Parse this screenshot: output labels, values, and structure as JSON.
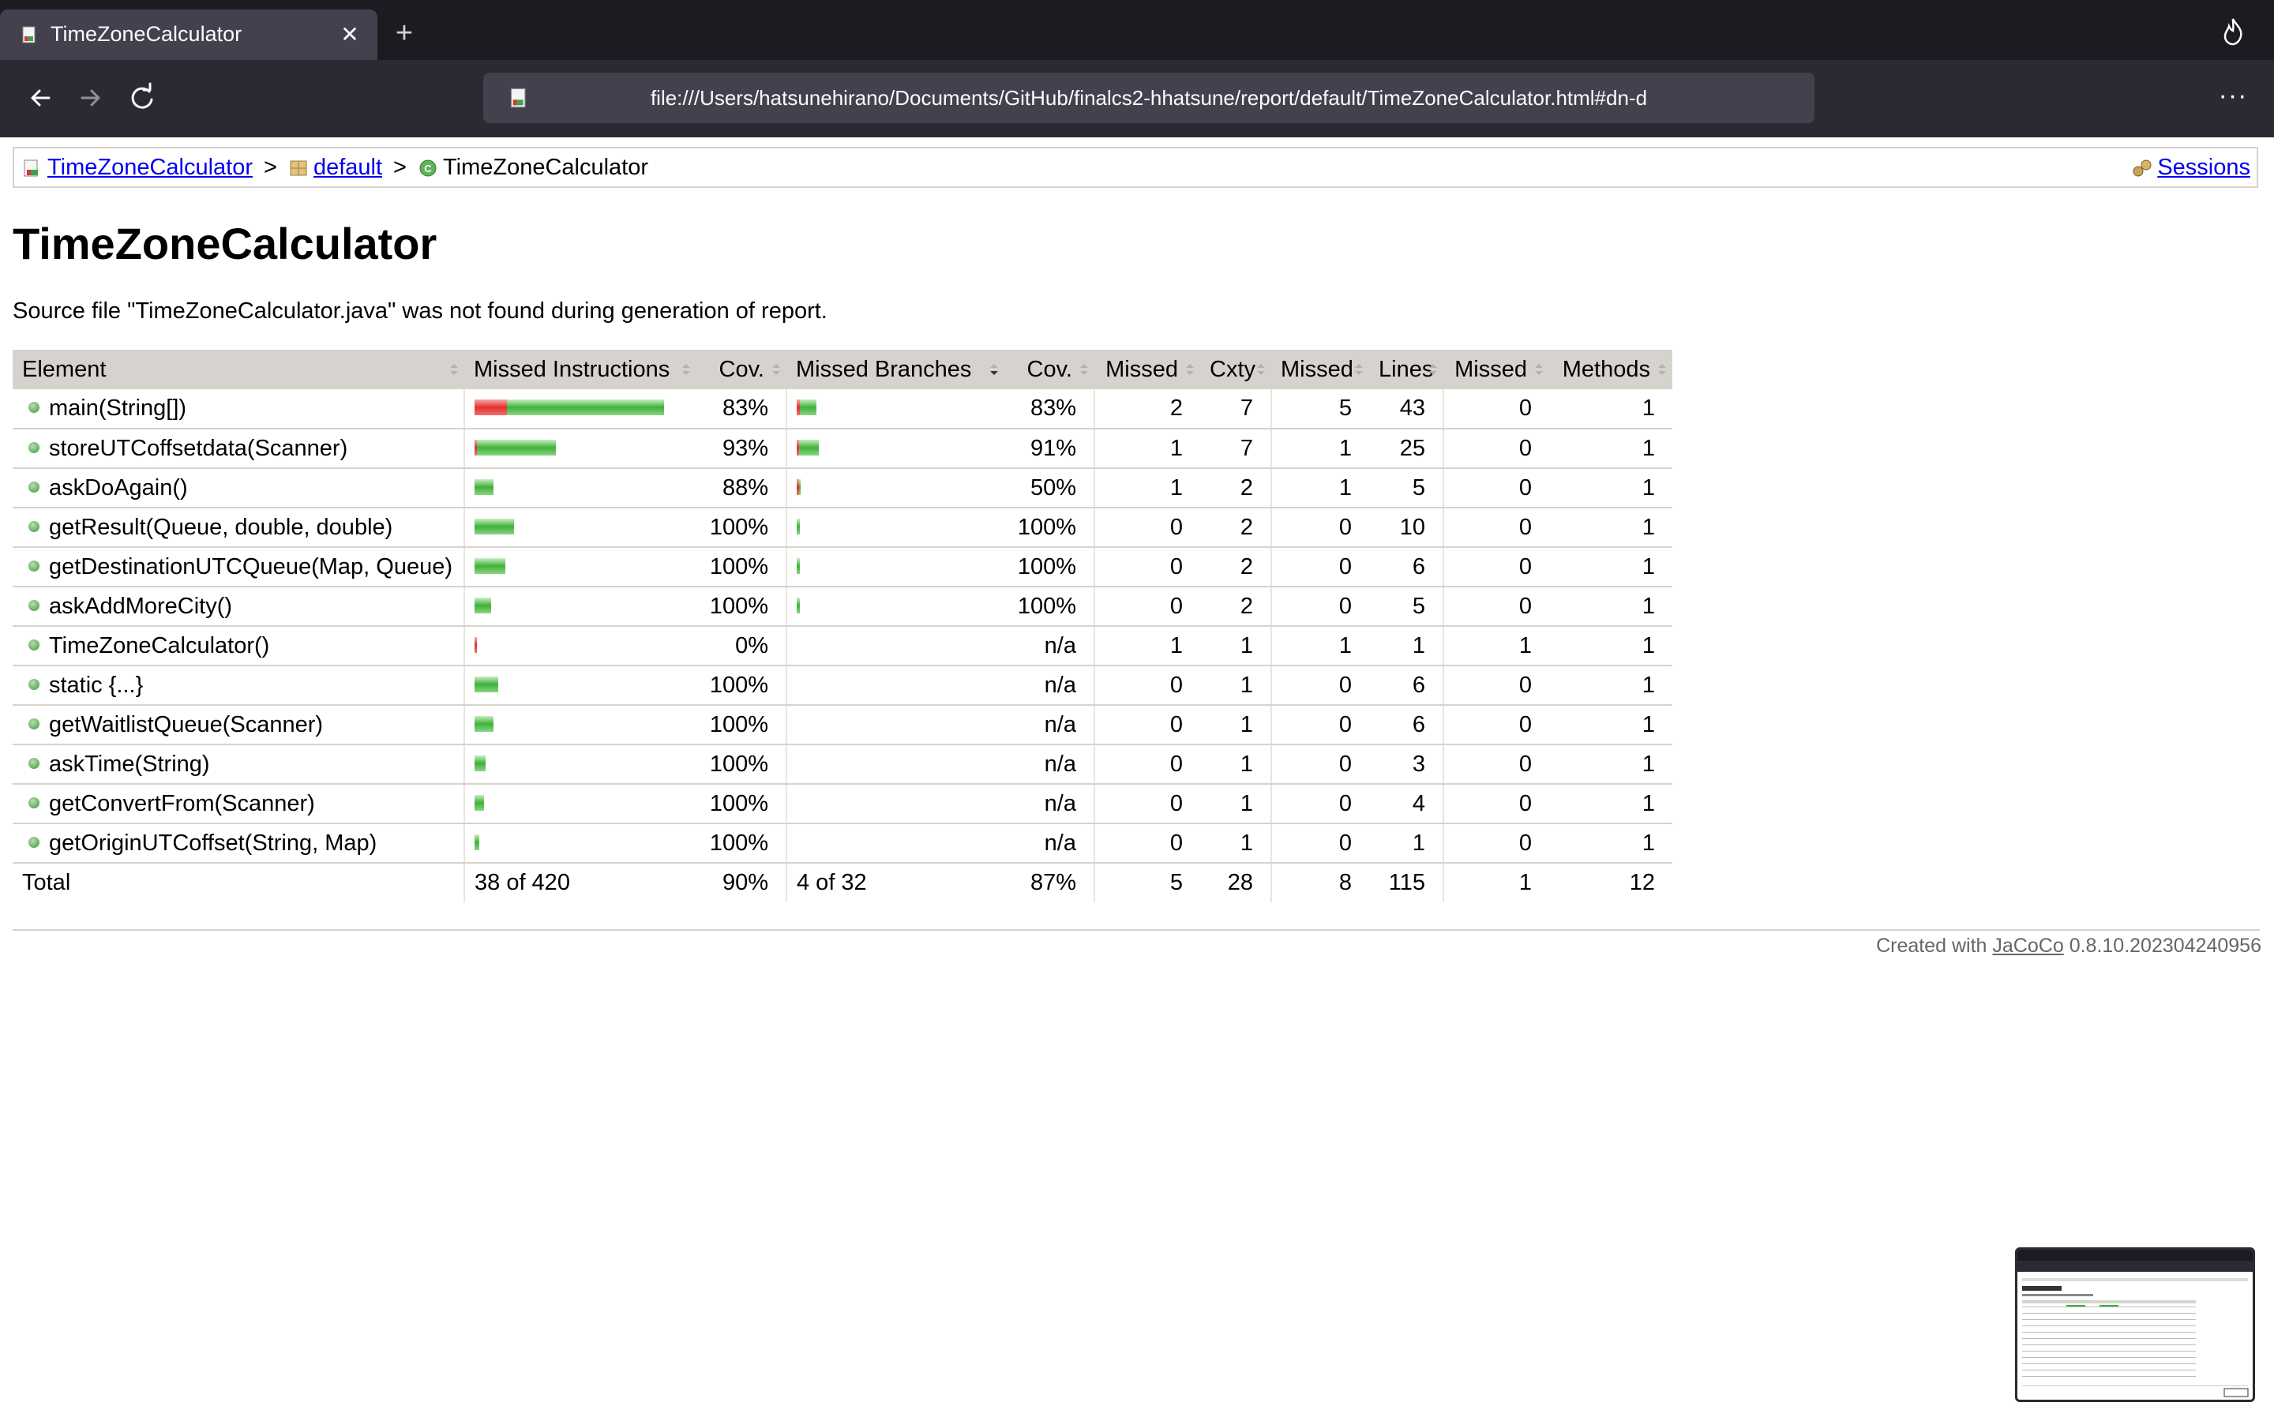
{
  "browser": {
    "tab_title": "TimeZoneCalculator",
    "close_glyph": "✕",
    "new_tab_glyph": "+",
    "url": "file:///Users/hatsunehirano/Documents/GitHub/finalcs2-hhatsune/report/default/TimeZoneCalculator.html#dn-d",
    "menu_glyph": "···",
    "icons": [
      "page-icon",
      "fire-icon",
      "back-arrow-icon",
      "forward-arrow-icon",
      "reload-icon",
      "more-menu-icon"
    ]
  },
  "breadcrumb": {
    "root": "TimeZoneCalculator",
    "package": "default",
    "current": "TimeZoneCalculator",
    "separator": ">",
    "sessions": "Sessions"
  },
  "page": {
    "title": "TimeZoneCalculator",
    "notice": "Source file \"TimeZoneCalculator.java\" was not found during generation of report."
  },
  "table": {
    "headers": [
      "Element",
      "Missed Instructions",
      "Cov.",
      "Missed Branches",
      "Cov.",
      "Missed",
      "Cxty",
      "Missed",
      "Lines",
      "Missed",
      "Methods"
    ],
    "rows": [
      {
        "element": "main(String[])",
        "instr_missed": 38,
        "instr_total": 224,
        "instr_cov": "83%",
        "branch_missed": 4,
        "branch_total": 24,
        "branch_cov": "83%",
        "cxty_missed": "2",
        "cxty": "7",
        "lines_missed": "5",
        "lines": "43",
        "methods_missed": "0",
        "methods": "1"
      },
      {
        "element": "storeUTCoffsetdata(Scanner)",
        "instr_missed": 1,
        "instr_total": 94,
        "instr_cov": "93%",
        "branch_missed": 1,
        "branch_total": 24,
        "branch_cov": "91%",
        "cxty_missed": "1",
        "cxty": "7",
        "lines_missed": "1",
        "lines": "25",
        "methods_missed": "0",
        "methods": "1"
      },
      {
        "element": "askDoAgain()",
        "instr_missed": 0,
        "instr_total": 22,
        "instr_cov": "88%",
        "branch_missed": 2,
        "branch_total": 4,
        "branch_cov": "50%",
        "cxty_missed": "1",
        "cxty": "2",
        "lines_missed": "1",
        "lines": "5",
        "methods_missed": "0",
        "methods": "1"
      },
      {
        "element": "getResult(Queue, double, double)",
        "instr_missed": 0,
        "instr_total": 47,
        "instr_cov": "100%",
        "branch_missed": 0,
        "branch_total": 4,
        "branch_cov": "100%",
        "cxty_missed": "0",
        "cxty": "2",
        "lines_missed": "0",
        "lines": "10",
        "methods_missed": "0",
        "methods": "1"
      },
      {
        "element": "getDestinationUTCQueue(Map, Queue)",
        "instr_missed": 0,
        "instr_total": 36,
        "instr_cov": "100%",
        "branch_missed": 0,
        "branch_total": 4,
        "branch_cov": "100%",
        "cxty_missed": "0",
        "cxty": "2",
        "lines_missed": "0",
        "lines": "6",
        "methods_missed": "0",
        "methods": "1"
      },
      {
        "element": "askAddMoreCity()",
        "instr_missed": 0,
        "instr_total": 20,
        "instr_cov": "100%",
        "branch_missed": 0,
        "branch_total": 4,
        "branch_cov": "100%",
        "cxty_missed": "0",
        "cxty": "2",
        "lines_missed": "0",
        "lines": "5",
        "methods_missed": "0",
        "methods": "1"
      },
      {
        "element": "TimeZoneCalculator()",
        "instr_missed": 3,
        "instr_total": 3,
        "instr_cov": "0%",
        "branch_missed": 0,
        "branch_total": 0,
        "branch_cov": "n/a",
        "cxty_missed": "1",
        "cxty": "1",
        "lines_missed": "1",
        "lines": "1",
        "methods_missed": "1",
        "methods": "1"
      },
      {
        "element": "static {...}",
        "instr_missed": 0,
        "instr_total": 28,
        "instr_cov": "100%",
        "branch_missed": 0,
        "branch_total": 0,
        "branch_cov": "n/a",
        "cxty_missed": "0",
        "cxty": "1",
        "lines_missed": "0",
        "lines": "6",
        "methods_missed": "0",
        "methods": "1"
      },
      {
        "element": "getWaitlistQueue(Scanner)",
        "instr_missed": 0,
        "instr_total": 22,
        "instr_cov": "100%",
        "branch_missed": 0,
        "branch_total": 0,
        "branch_cov": "n/a",
        "cxty_missed": "0",
        "cxty": "1",
        "lines_missed": "0",
        "lines": "6",
        "methods_missed": "0",
        "methods": "1"
      },
      {
        "element": "askTime(String)",
        "instr_missed": 0,
        "instr_total": 13,
        "instr_cov": "100%",
        "branch_missed": 0,
        "branch_total": 0,
        "branch_cov": "n/a",
        "cxty_missed": "0",
        "cxty": "1",
        "lines_missed": "0",
        "lines": "3",
        "methods_missed": "0",
        "methods": "1"
      },
      {
        "element": "getConvertFrom(Scanner)",
        "instr_missed": 0,
        "instr_total": 11,
        "instr_cov": "100%",
        "branch_missed": 0,
        "branch_total": 0,
        "branch_cov": "n/a",
        "cxty_missed": "0",
        "cxty": "1",
        "lines_missed": "0",
        "lines": "4",
        "methods_missed": "0",
        "methods": "1"
      },
      {
        "element": "getOriginUTCoffset(String, Map)",
        "instr_missed": 0,
        "instr_total": 6,
        "instr_cov": "100%",
        "branch_missed": 0,
        "branch_total": 0,
        "branch_cov": "n/a",
        "cxty_missed": "0",
        "cxty": "1",
        "lines_missed": "0",
        "lines": "1",
        "methods_missed": "0",
        "methods": "1"
      }
    ],
    "total": {
      "label": "Total",
      "instr": "38 of 420",
      "instr_cov": "90%",
      "branch": "4 of 32",
      "branch_cov": "87%",
      "cxty_missed": "5",
      "cxty": "28",
      "lines_missed": "8",
      "lines": "115",
      "methods_missed": "1",
      "methods": "12"
    },
    "bar_scale_max": 224,
    "colors": {
      "missed": "#e03030",
      "covered": "#3fb03a",
      "header_bg": "#d6d3ce"
    }
  },
  "footer": {
    "prefix": "Created with",
    "link": "JaCoCo",
    "version": "0.8.10.202304240956"
  }
}
